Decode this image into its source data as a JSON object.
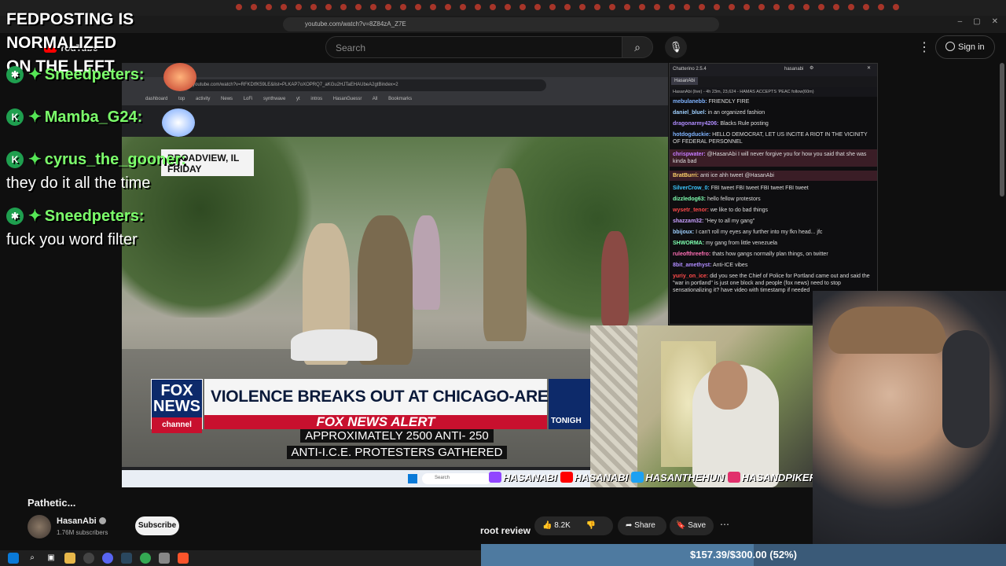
{
  "browser": {
    "url": "youtube.com/watch?v=8Z84zA_Z7E"
  },
  "youtube": {
    "logo": "YouTube",
    "search_placeholder": "Search",
    "sign_in": "Sign in",
    "video_title": "Pathetic...",
    "channel_name": "HasanAbi",
    "subscribers": "1.76M subscribers",
    "subscribe": "Subscribe",
    "likes": "8.2K",
    "share": "Share",
    "save": "Save",
    "root_review": "root review"
  },
  "overlay": {
    "banner_line1": "FEDPOSTING IS NORMALIZED",
    "banner_line2": "ON THE LEFT",
    "chat": [
      {
        "badge": "✱",
        "user": "Sneedpeters:",
        "message": ""
      },
      {
        "badge": "K",
        "user": "Mamba_G24:",
        "message": ""
      },
      {
        "badge": "K",
        "user": "cyrus_the_gooner:",
        "message": "they do it all the time"
      },
      {
        "badge": "✱",
        "user": "Sneedpeters:",
        "message": "fuck you word filter"
      }
    ]
  },
  "inner_browser": {
    "url": "youtube.com/watch?v=RFKDtfK59LE&list=PLKAP7oXOPRQ7_aKGu2HJTaEHAUbeA2gtBindex=2",
    "bookmarks": "dashboard top activity News LoFi synthwave yt intros HasanGuessr All Bookmarks",
    "taskbar_search": "Search"
  },
  "news": {
    "location_line1": "BROADVIEW, IL",
    "location_line2": "FRIDAY",
    "logo_line1": "FOX",
    "logo_line2": "NEWS",
    "logo_channel": "channel",
    "headline": "VIOLENCE BREAKS OUT AT CHICAGO-AREA I.C.E. PROTEST",
    "alert": "FOX NEWS ALERT",
    "side_label": "TONIGH",
    "caption_line1": "APPROXIMATELY 2500 ANTI- 250",
    "caption_line2": "ANTI-I.C.E. PROTESTERS GATHERED"
  },
  "chatterino": {
    "title": "Chatterino 2.5.4",
    "account": "hasanabi",
    "tab": "HasanAbi",
    "header": "HasanAbi (live) - 4h 23m, 23,624 - HAMAS ACCEPTS 'PEAC  follow(60m)",
    "messages": [
      {
        "user": "mebulanebb:",
        "text": "FRIENDLY FIRE",
        "color": "#7fb3ff",
        "highlight": false
      },
      {
        "user": "daniel_bluel:",
        "text": "in an organized fashion",
        "color": "#9fd0ff",
        "highlight": false
      },
      {
        "user": "dragonarmy4206:",
        "text": "Blacks Rule posting",
        "color": "#b08cff",
        "highlight": false
      },
      {
        "user": "hotdogduckie:",
        "text": "HELLO DEMOCRAT, LET US INCITE A RIOT IN THE VICINITY OF FEDERAL PERSONNEL",
        "color": "#7fb3ff",
        "highlight": false
      },
      {
        "user": "chrispwater:",
        "text": "@HasanAbi I will never forgive you for how you said that she was kinda bad",
        "color": "#c67bff",
        "highlight": true
      },
      {
        "user": "BratBurri:",
        "text": "anti ice ahh tweet @HasanAbi",
        "color": "#ffd36b",
        "highlight": true
      },
      {
        "user": "SilverCrow_0:",
        "text": "FBI tweet FBI tweet FBI tweet FBI tweet",
        "color": "#3cc7ff",
        "highlight": false
      },
      {
        "user": "dizzledog63:",
        "text": "hello fellow protestors",
        "color": "#7fffb0",
        "highlight": false
      },
      {
        "user": "wysetr_tenor:",
        "text": "we like to do bad things",
        "color": "#ff4a4a",
        "highlight": false
      },
      {
        "user": "shazzam32:",
        "text": "\"Hey to all my gang\"",
        "color": "#c9a0ff",
        "highlight": false
      },
      {
        "user": "bbijoux:",
        "text": "I can't roll my eyes any further into my fkn head... jfc",
        "color": "#9fd0ff",
        "highlight": false
      },
      {
        "user": "SHWORMA:",
        "text": "my gang from little venezuela",
        "color": "#7fffb0",
        "highlight": false
      },
      {
        "user": "ruleofthreefro:",
        "text": "thats how gangs normally plan things, on twitter",
        "color": "#ff6fb5",
        "highlight": false
      },
      {
        "user": "8bit_amethyst:",
        "text": "Anti-ICE vibes",
        "color": "#b08cff",
        "highlight": false
      },
      {
        "user": "yuriy_on_ice:",
        "text": "did you see the Chief of Police for Portland came out and said the \"war in portland\" is just one block and people (fox news) need to stop sensationalizing it? have video with timestamp if needed",
        "color": "#ff4a4a",
        "highlight": false
      }
    ]
  },
  "socials": [
    "HASANABI",
    "HASANABI",
    "HASANTHEHUN",
    "HASANDPIKER"
  ],
  "goal": {
    "text": "$157.39/$300.00 (52%)",
    "fraction": 0.52
  },
  "colors": {
    "accent_green": "#7CFF6B",
    "fox_red": "#c8102e",
    "fox_blue": "#0d2a6a"
  }
}
